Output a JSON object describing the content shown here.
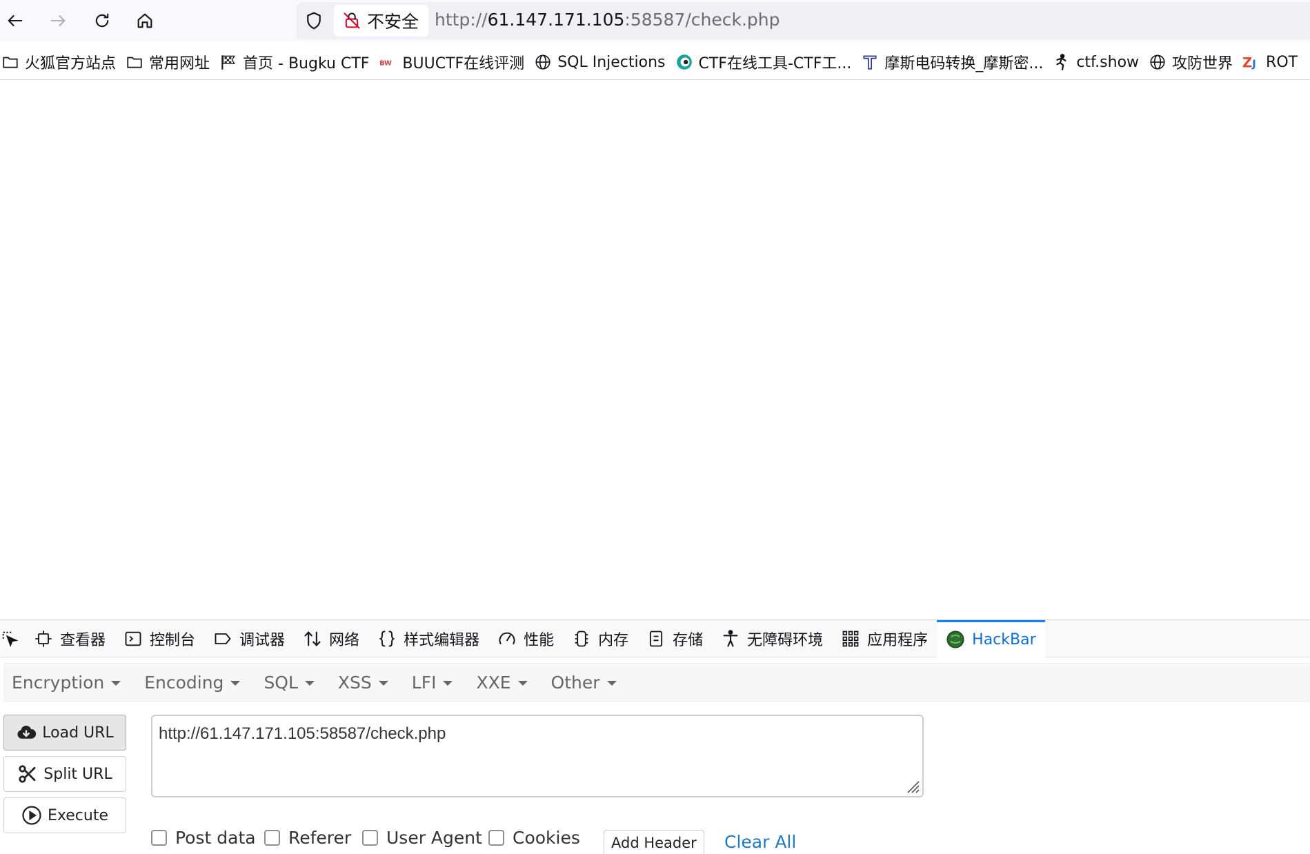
{
  "urlbar": {
    "insecure_label": "不安全",
    "url_prefix": "http://",
    "url_host": "61.147.171.105",
    "url_rest": ":58587/check.php"
  },
  "bookmarks": [
    {
      "label": "火狐官方站点",
      "icon": "folder-icon"
    },
    {
      "label": "常用网址",
      "icon": "folder-icon"
    },
    {
      "label": "首页 - Bugku CTF",
      "icon": "flag-icon"
    },
    {
      "label": "BUUCTF在线评测",
      "icon": "buuctf-icon"
    },
    {
      "label": "SQL Injections",
      "icon": "globe-icon"
    },
    {
      "label": "CTF在线工具-CTF工...",
      "icon": "ctf-tool-icon"
    },
    {
      "label": "摩斯电码转换_摩斯密...",
      "icon": "t-letter-icon"
    },
    {
      "label": "ctf.show",
      "icon": "runner-icon"
    },
    {
      "label": "攻防世界",
      "icon": "globe-icon"
    },
    {
      "label": "ROT",
      "icon": "zj-icon"
    }
  ],
  "devtools": {
    "tabs": [
      {
        "label": "查看器",
        "icon": "inspector-icon"
      },
      {
        "label": "控制台",
        "icon": "console-icon"
      },
      {
        "label": "调试器",
        "icon": "debugger-icon"
      },
      {
        "label": "网络",
        "icon": "network-icon"
      },
      {
        "label": "样式编辑器",
        "icon": "braces-icon"
      },
      {
        "label": "性能",
        "icon": "gauge-icon"
      },
      {
        "label": "内存",
        "icon": "memory-icon"
      },
      {
        "label": "存储",
        "icon": "storage-icon"
      },
      {
        "label": "无障碍环境",
        "icon": "accessibility-icon"
      },
      {
        "label": "应用程序",
        "icon": "grid-icon"
      },
      {
        "label": "HackBar",
        "icon": "hackbar-icon"
      }
    ],
    "active_tab": "HackBar"
  },
  "hackbar": {
    "menus": [
      "Encryption",
      "Encoding",
      "SQL",
      "XSS",
      "LFI",
      "XXE",
      "Other"
    ],
    "load_url": "Load URL",
    "split_url": "Split URL",
    "execute": "Execute",
    "url_value": "http://61.147.171.105:58587/check.php",
    "options": [
      "Post data",
      "Referer",
      "User Agent",
      "Cookies"
    ],
    "add_header": "Add Header",
    "clear_all": "Clear All"
  },
  "colors": {
    "accent": "#0a84ff",
    "link": "#1e7ac5",
    "toolbar_bg": "#f9f9fb"
  }
}
